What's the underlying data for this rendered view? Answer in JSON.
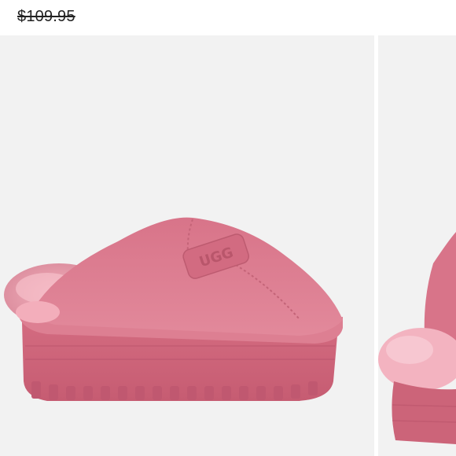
{
  "listing": {
    "original_price": "$109.95"
  },
  "gallery": {
    "main_image": {
      "icon": "ugg-slipper-photo",
      "product_color": "#d9738a",
      "logo_text": "UGG"
    },
    "next_image": {
      "icon": "ugg-slipper-photo-side"
    }
  }
}
